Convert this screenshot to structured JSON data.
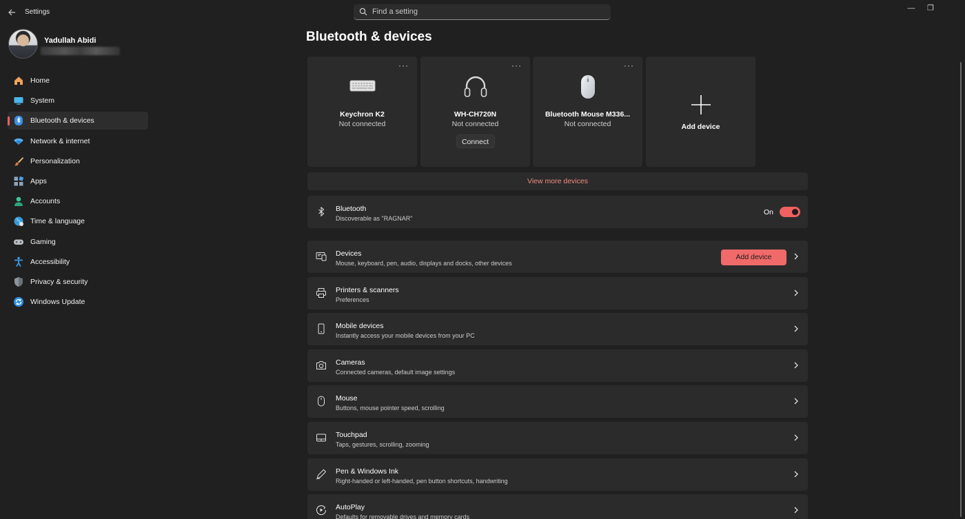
{
  "window": {
    "title": "Settings",
    "search_placeholder": "Find a setting",
    "controls": {
      "minimize": "—",
      "restore": "❐"
    }
  },
  "user": {
    "name": "Yadullah Abidi"
  },
  "sidebar": {
    "items": [
      {
        "label": "Home",
        "icon": "home-icon",
        "active": false
      },
      {
        "label": "System",
        "icon": "system-icon",
        "active": false
      },
      {
        "label": "Bluetooth & devices",
        "icon": "bluetooth-icon",
        "active": true
      },
      {
        "label": "Network & internet",
        "icon": "wifi-icon",
        "active": false
      },
      {
        "label": "Personalization",
        "icon": "brush-icon",
        "active": false
      },
      {
        "label": "Apps",
        "icon": "apps-icon",
        "active": false
      },
      {
        "label": "Accounts",
        "icon": "accounts-icon",
        "active": false
      },
      {
        "label": "Time & language",
        "icon": "globe-icon",
        "active": false
      },
      {
        "label": "Gaming",
        "icon": "gamepad-icon",
        "active": false
      },
      {
        "label": "Accessibility",
        "icon": "accessibility-icon",
        "active": false
      },
      {
        "label": "Privacy & security",
        "icon": "shield-icon",
        "active": false
      },
      {
        "label": "Windows Update",
        "icon": "update-icon",
        "active": false
      }
    ]
  },
  "main": {
    "title": "Bluetooth & devices",
    "device_cards": [
      {
        "name": "Keychron K2",
        "status": "Not connected",
        "icon": "keyboard-icon"
      },
      {
        "name": "WH-CH720N",
        "status": "Not connected",
        "icon": "headphones-icon",
        "button": "Connect"
      },
      {
        "name": "Bluetooth Mouse M336...",
        "status": "Not connected",
        "icon": "mouse-device-icon"
      }
    ],
    "add_card_label": "Add device",
    "more_glyph": "···",
    "view_more": "View more devices",
    "bluetooth_row": {
      "title": "Bluetooth",
      "subtitle": "Discoverable as \"RAGNAR\"",
      "toggle_label": "On",
      "toggle_on": true
    },
    "rows": [
      {
        "title": "Devices",
        "subtitle": "Mouse, keyboard, pen, audio, displays and docks, other devices",
        "icon": "devices-icon",
        "button": "Add device"
      },
      {
        "title": "Printers & scanners",
        "subtitle": "Preferences",
        "icon": "printer-icon"
      },
      {
        "title": "Mobile devices",
        "subtitle": "Instantly access your mobile devices from your PC",
        "icon": "phone-icon"
      },
      {
        "title": "Cameras",
        "subtitle": "Connected cameras, default image settings",
        "icon": "camera-icon"
      },
      {
        "title": "Mouse",
        "subtitle": "Buttons, mouse pointer speed, scrolling",
        "icon": "mouse-icon"
      },
      {
        "title": "Touchpad",
        "subtitle": "Taps, gestures, scrolling, zooming",
        "icon": "touchpad-icon"
      },
      {
        "title": "Pen & Windows Ink",
        "subtitle": "Right-handed or left-handed, pen button shortcuts, handwriting",
        "icon": "pen-icon"
      },
      {
        "title": "AutoPlay",
        "subtitle": "Defaults for removable drives and memory cards",
        "icon": "autoplay-icon"
      }
    ]
  },
  "colors": {
    "accent": "#f06060",
    "background": "#202020",
    "card": "#2b2b2b",
    "link": "#f28b82"
  }
}
